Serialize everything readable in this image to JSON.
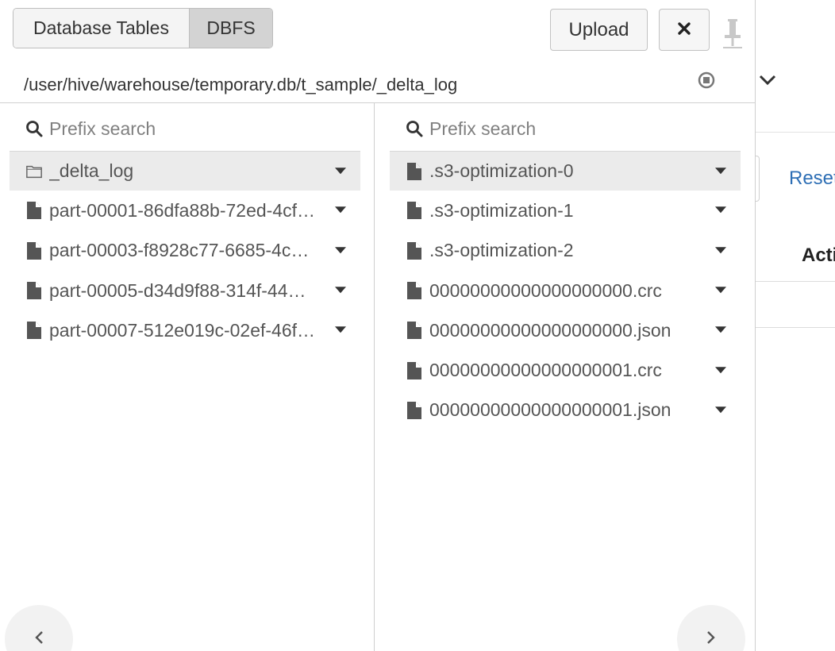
{
  "tabs": [
    {
      "label": "Database Tables",
      "active": false
    },
    {
      "label": "DBFS",
      "active": true
    }
  ],
  "toolbar": {
    "upload_label": "Upload",
    "close_icon": "close-icon",
    "pin_icon": "pin-icon"
  },
  "path": "/user/hive/warehouse/temporary.db/t_sample/_delta_log",
  "left_column": {
    "search_placeholder": "Prefix search",
    "items": [
      {
        "name": "_delta_log",
        "type": "folder",
        "selected": true
      },
      {
        "name": "part-00001-86dfa88b-72ed-4cf…",
        "type": "file",
        "selected": false
      },
      {
        "name": "part-00003-f8928c77-6685-4c…",
        "type": "file",
        "selected": false
      },
      {
        "name": "part-00005-d34d9f88-314f-44…",
        "type": "file",
        "selected": false
      },
      {
        "name": "part-00007-512e019c-02ef-46f…",
        "type": "file",
        "selected": false
      }
    ]
  },
  "right_column": {
    "search_placeholder": "Prefix search",
    "items": [
      {
        "name": ".s3-optimization-0",
        "type": "file",
        "selected": true
      },
      {
        "name": ".s3-optimization-1",
        "type": "file",
        "selected": false
      },
      {
        "name": ".s3-optimization-2",
        "type": "file",
        "selected": false
      },
      {
        "name": "00000000000000000000.crc",
        "type": "file",
        "selected": false
      },
      {
        "name": "00000000000000000000.json",
        "type": "file",
        "selected": false
      },
      {
        "name": "00000000000000000001.crc",
        "type": "file",
        "selected": false
      },
      {
        "name": "00000000000000000001.json",
        "type": "file",
        "selected": false
      }
    ]
  },
  "background": {
    "reset_label": "Reset",
    "actions_header": "Acti"
  },
  "colors": {
    "link": "#2e6fb5",
    "selected_row": "#ebebeb",
    "active_tab": "#d3d3d3"
  }
}
